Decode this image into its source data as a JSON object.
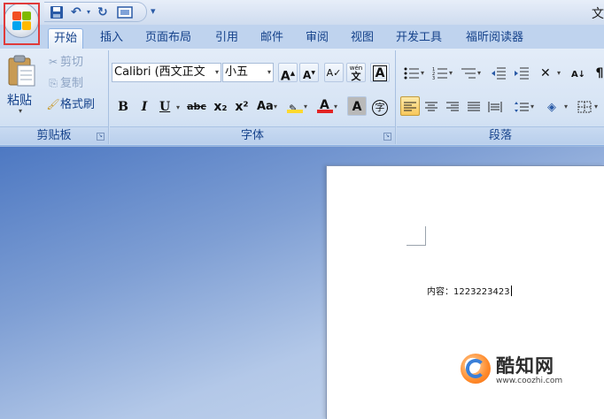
{
  "titlebar": {
    "title": "文"
  },
  "quick_access": {
    "save_icon": "save-icon",
    "undo_icon": "undo-icon",
    "redo_icon": "redo-icon",
    "print_preview_icon": "print-preview-icon",
    "customize_icon": "customize-qat-icon"
  },
  "tabs": [
    {
      "label": "开始",
      "active": true
    },
    {
      "label": "插入"
    },
    {
      "label": "页面布局"
    },
    {
      "label": "引用"
    },
    {
      "label": "邮件"
    },
    {
      "label": "审阅"
    },
    {
      "label": "视图"
    },
    {
      "label": "开发工具"
    },
    {
      "label": "福昕阅读器"
    }
  ],
  "clipboard": {
    "label": "剪贴板",
    "paste": "粘贴",
    "cut": "剪切",
    "copy": "复制",
    "format_painter": "格式刷"
  },
  "font": {
    "label": "字体",
    "font_name": "Calibri (西文正文",
    "font_size": "小五",
    "grow_label": "A",
    "shrink_label": "A",
    "phonetic_label": "wén",
    "phonetic_char": "文",
    "border_char": "A",
    "bold": "B",
    "italic": "I",
    "underline": "U",
    "strikethrough": "abc",
    "subscript": "x₂",
    "superscript": "x²",
    "change_case": "Aa",
    "font_color_char": "A",
    "char_shading": "A",
    "enclose_char": "字"
  },
  "paragraph": {
    "label": "段落"
  },
  "document": {
    "content": "内容：1223223423"
  },
  "watermark": {
    "name": "酷知网",
    "url": "www.coozhi.com"
  },
  "colors": {
    "accent_red": "#e03a3a",
    "highlight_yellow": "#ffd92f",
    "font_color_red": "#e32424",
    "active_align": "#f8c85c"
  }
}
